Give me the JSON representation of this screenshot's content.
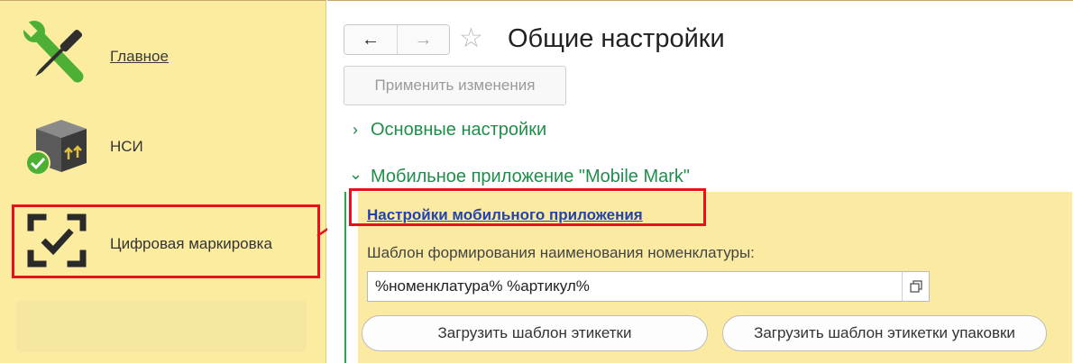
{
  "sidebar": {
    "items": [
      {
        "label": "Главное",
        "icon": "tools-icon"
      },
      {
        "label": "НСИ",
        "icon": "boxes-icon"
      },
      {
        "label": "Цифровая маркировка",
        "icon": "scan-check-icon"
      }
    ]
  },
  "header": {
    "title": "Общие настройки",
    "back_glyph": "←",
    "forward_glyph": "→",
    "star_glyph": "☆"
  },
  "toolbar": {
    "apply_label": "Применить изменения"
  },
  "sections": {
    "basic": {
      "label": "Основные настройки",
      "chev": "›"
    },
    "mobile": {
      "label": "Мобильное приложение \"Mobile Mark\"",
      "chev": "⌄"
    }
  },
  "mobile_panel": {
    "settings_link": "Настройки мобильного приложения",
    "template_caption": "Шаблон формирования наименования номенклатуры:",
    "template_value": "%номенклатура% %артикул%",
    "load_label_button": "Загрузить шаблон этикетки",
    "load_pack_label_button": "Загрузить шаблон этикетки упаковки"
  },
  "colors": {
    "sidebar_bg": "#fbeca0",
    "panel_bg": "#fbeba2",
    "section_green": "#1f8e4a",
    "highlight_red": "#e8101a",
    "link_blue": "#2244aa"
  }
}
